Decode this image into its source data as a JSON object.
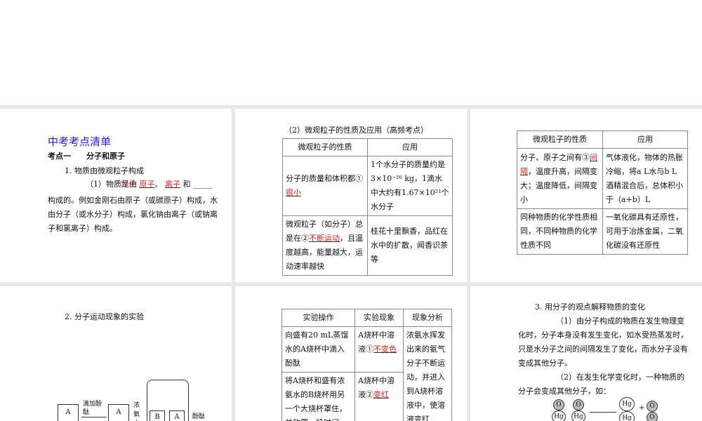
{
  "panel1": {
    "title": "中考考点清单",
    "heading": "考点一　　分子和原子",
    "sub": "1. 物质由微观粒子构成",
    "para_prefix": "（1）物质是由",
    "blank1": "原子",
    "sep": "、",
    "blank2": "离子",
    "and": "和",
    "blank3": "分子",
    "para_rest": "构成的。例如金刚石由原子（或碳原子）构成，水由分子（或水分子）构成，氯化钠由离子（或钠离子和氯离子）构成。"
  },
  "panel2": {
    "caption": "（2）微观粒子的性质及应用（高频考点）",
    "headers": [
      "微观粒子的性质",
      "应用"
    ],
    "r1c1_pre": "分子的质量和体积都①",
    "r1c1_ans": "很小",
    "r1c2": "1个水分子的质量约是3×10⁻²⁶ kg，1滴水中大约有1.67×10²¹个水分子",
    "r2c1_pre": "微观粒子（如分子）总是在②",
    "r2c1_ans": "不断运动",
    "r2c1_post": "，且温度越高，能量越大，运动速率越快",
    "r2c2": "桂花十里飘香，品红在水中的扩散，闻香识茶等"
  },
  "panel3": {
    "headers": [
      "微观粒子的性质",
      "应用"
    ],
    "r1c1_pre": "分子、原子之间有③",
    "r1c1_ans": "间隔",
    "r1c1_post": "，温度升高，间隔变大；温度降低，间隔变小",
    "r1c2": "气体液化，物体的热胀冷缩，将a L水与b L酒精混合后，总体积小于（a+b）L",
    "r2c1": "同种物质的化学性质相同，不同种物质的化学性质不同",
    "r2c2": "一氧化碳具有还原性，可用于冶炼金属，二氧化碳没有还原性"
  },
  "panel4": {
    "heading": "2. 分子运动现象的实验",
    "labels": {
      "a": "A",
      "b": "B",
      "drop": "滴加酚酞",
      "ammonia": "浓氨水",
      "phenol": "酚酞"
    }
  },
  "panel5": {
    "headers": [
      "实验操作",
      "实验现象",
      "现象分析"
    ],
    "r1c1": "向盛有20 mL蒸馏水的A烧杯中滴入酚酞",
    "r1c2_pre": "A烧杯中溶液①",
    "r1c2_ans": "不变色",
    "r2c1": "将A烧杯和盛有浓氨水的B烧杯用另一个大烧杯罩住，并放置一段时间",
    "r2c2_pre": "A烧杯中溶液②",
    "r2c2_ans": "变红",
    "c3": "浓氨水挥发出来的氨气分子不断运动，并进入到A烧杯溶液中，使溶液变红"
  },
  "panel6": {
    "heading": "3. 用分子的观点解释物质的变化",
    "p1": "（1）由分子构成的物质在发生物理变化时，分子本身没有发生变化，如水受热蒸发时，只是水分子之间的间隔发生了变化，而水分子没有变成其他分子。",
    "p2": "（2）在发生化学变化时，一种物质的分子会变成其他分子，如：",
    "atoms": {
      "o": "O",
      "hg": "Hg",
      "plus": "+"
    }
  }
}
